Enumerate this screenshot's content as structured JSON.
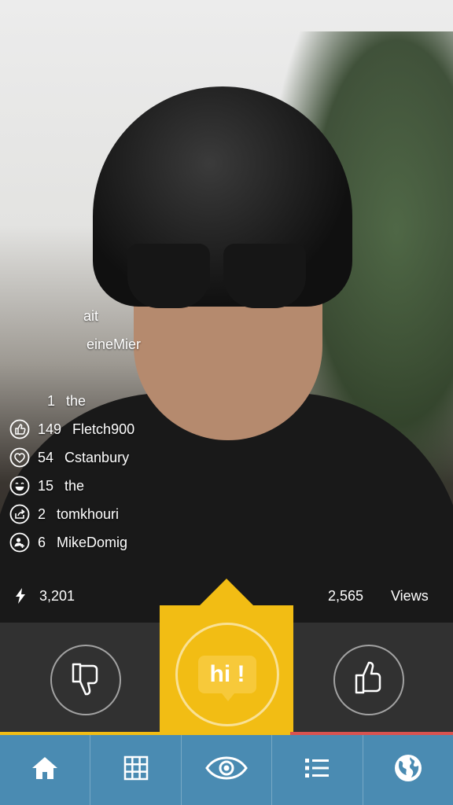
{
  "feed": {
    "partial_rows": [
      {
        "text": "ait"
      },
      {
        "text": "eineMier"
      },
      {
        "count": "1",
        "name": "the"
      }
    ],
    "rows": [
      {
        "icon": "thumbs-up-icon",
        "count": "149",
        "name": "Fletch900"
      },
      {
        "icon": "heart-icon",
        "count": "54",
        "name": "Cstanbury"
      },
      {
        "icon": "smile-icon",
        "count": "15",
        "name": "the"
      },
      {
        "icon": "share-icon",
        "count": "2",
        "name": "tomkhouri"
      },
      {
        "icon": "add-user-icon",
        "count": "6",
        "name": "MikeDomig"
      }
    ]
  },
  "stats": {
    "likes": "3,201",
    "views_count": "2,565",
    "views_label": "Views"
  },
  "actions": {
    "hi_label": "hi !"
  },
  "playback": {
    "progress": 0.64
  },
  "nav": {
    "tabs": [
      "home-icon",
      "grid-icon",
      "eye-icon",
      "list-icon",
      "globe-icon"
    ]
  },
  "colors": {
    "accent": "#f2bd14",
    "nav": "#4a8bb2",
    "progress_remaining": "#d9534f"
  }
}
